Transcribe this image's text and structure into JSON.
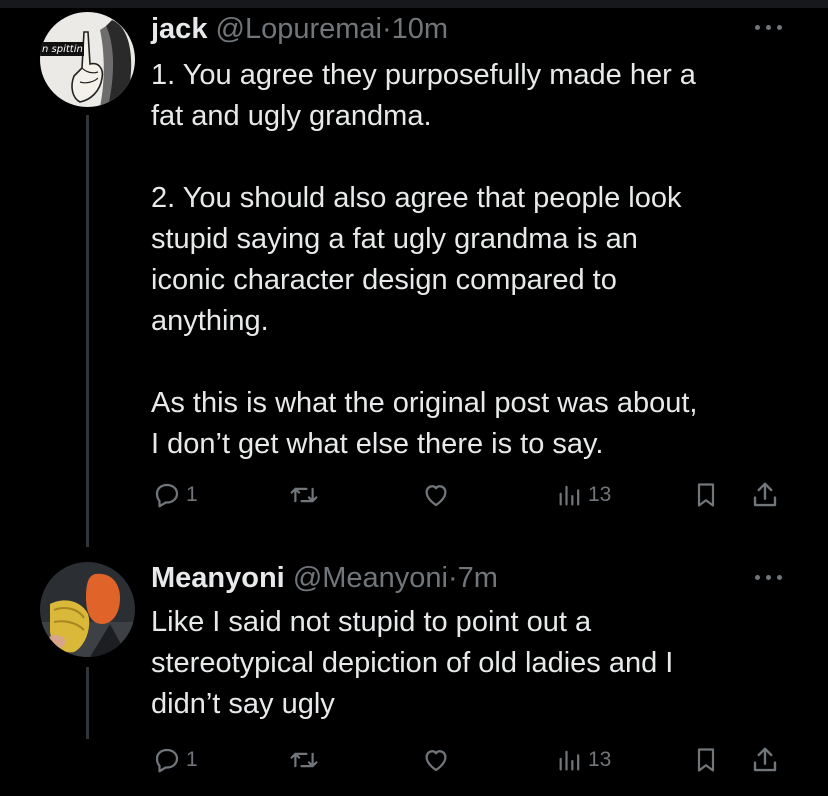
{
  "tweets": [
    {
      "avatar_label": "n spittin",
      "name": "jack",
      "handle": "@Lopuremai",
      "separator": "·",
      "time": "10m",
      "paragraphs": [
        "1. You agree they purposefully made her a\nfat and ugly grandma.",
        "2. You should also agree that people look\nstupid saying a fat ugly grandma is an\niconic character design compared to\nanything.",
        "As this is what the original post was about,\nI don’t get what else there is to say."
      ],
      "reply_count": "1",
      "views_count": "13"
    },
    {
      "name": "Meanyoni",
      "handle": "@Meanyoni",
      "separator": "·",
      "time": "7m",
      "paragraphs": [
        "Like I said not stupid to point out a\nstereotypical depiction of old ladies and I\ndidn’t say ugly"
      ],
      "reply_count": "1",
      "views_count": "13"
    }
  ],
  "colors": {
    "background": "#000000",
    "text": "#e7e9ea",
    "muted": "#71767b",
    "thread_line": "#333639"
  },
  "icons": [
    "reply-icon",
    "retweet-icon",
    "like-icon",
    "views-icon",
    "bookmark-icon",
    "share-icon",
    "more-options-icon"
  ]
}
